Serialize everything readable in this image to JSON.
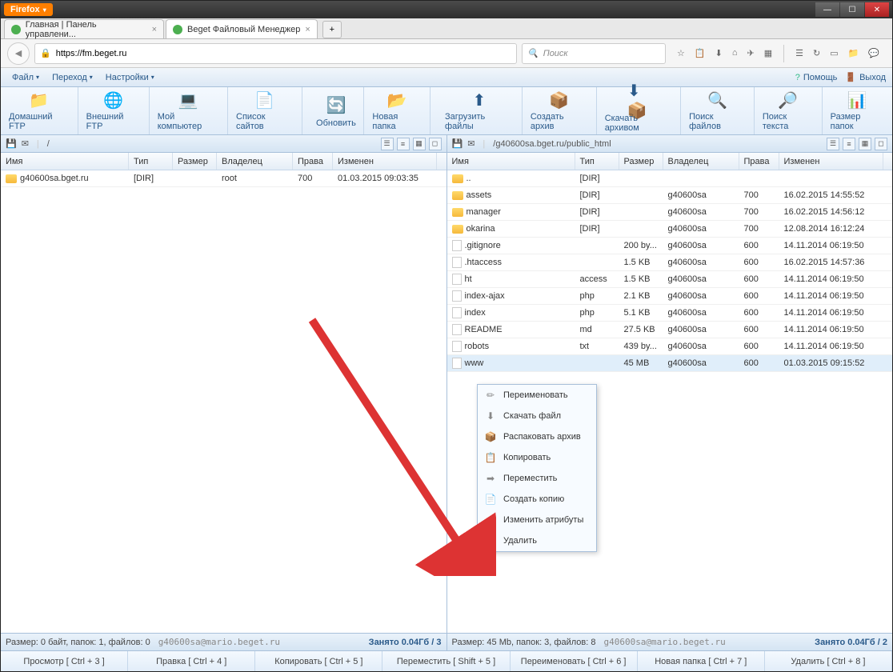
{
  "browser": {
    "name": "Firefox",
    "url": "https://fm.beget.ru",
    "search_placeholder": "Поиск"
  },
  "tabs": [
    {
      "title": "Главная | Панель управлени..."
    },
    {
      "title": "Beget Файловый Менеджер"
    }
  ],
  "menu": {
    "file": "Файл",
    "go": "Переход",
    "settings": "Настройки",
    "help": "Помощь",
    "exit": "Выход"
  },
  "toolbar": [
    {
      "label": "Домашний FTP"
    },
    {
      "label": "Внешний FTP"
    },
    {
      "label": "Мой компьютер"
    },
    {
      "label": "Список сайтов"
    },
    {
      "label": "Обновить"
    },
    {
      "label": "Новая папка"
    },
    {
      "label": "Загрузить файлы"
    },
    {
      "label": "Создать архив"
    },
    {
      "label": "Скачать архивом"
    },
    {
      "label": "Поиск файлов"
    },
    {
      "label": "Поиск текста"
    },
    {
      "label": "Размер папок"
    }
  ],
  "columns": {
    "name": "Имя",
    "type": "Тип",
    "size": "Размер",
    "owner": "Владелец",
    "perm": "Права",
    "modified": "Изменен"
  },
  "left_pane": {
    "path": "/",
    "rows": [
      {
        "name": "g40600sa.bget.ru",
        "type": "[DIR]",
        "size": "",
        "owner": "root",
        "perm": "700",
        "modified": "01.03.2015 09:03:35",
        "folder": true
      }
    ],
    "status": "Размер: 0 байт, папок: 1, файлов: 0",
    "user": "g40600sa@mario.beget.ru",
    "quota": "Занято 0.04Гб / 3"
  },
  "right_pane": {
    "path": "/g40600sa.bget.ru/public_html",
    "rows": [
      {
        "name": "..",
        "type": "[DIR]",
        "size": "",
        "owner": "",
        "perm": "",
        "modified": "",
        "folder": true
      },
      {
        "name": "assets",
        "type": "[DIR]",
        "size": "",
        "owner": "g40600sa",
        "perm": "700",
        "modified": "16.02.2015 14:55:52",
        "folder": true
      },
      {
        "name": "manager",
        "type": "[DIR]",
        "size": "",
        "owner": "g40600sa",
        "perm": "700",
        "modified": "16.02.2015 14:56:12",
        "folder": true
      },
      {
        "name": "okarina",
        "type": "[DIR]",
        "size": "",
        "owner": "g40600sa",
        "perm": "700",
        "modified": "12.08.2014 16:12:24",
        "folder": true
      },
      {
        "name": ".gitignore",
        "type": "",
        "size": "200 by...",
        "owner": "g40600sa",
        "perm": "600",
        "modified": "14.11.2014 06:19:50",
        "folder": false
      },
      {
        "name": ".htaccess",
        "type": "",
        "size": "1.5 KB",
        "owner": "g40600sa",
        "perm": "600",
        "modified": "16.02.2015 14:57:36",
        "folder": false
      },
      {
        "name": "ht",
        "type": "access",
        "size": "1.5 KB",
        "owner": "g40600sa",
        "perm": "600",
        "modified": "14.11.2014 06:19:50",
        "folder": false
      },
      {
        "name": "index-ajax",
        "type": "php",
        "size": "2.1 KB",
        "owner": "g40600sa",
        "perm": "600",
        "modified": "14.11.2014 06:19:50",
        "folder": false
      },
      {
        "name": "index",
        "type": "php",
        "size": "5.1 KB",
        "owner": "g40600sa",
        "perm": "600",
        "modified": "14.11.2014 06:19:50",
        "folder": false
      },
      {
        "name": "README",
        "type": "md",
        "size": "27.5 KB",
        "owner": "g40600sa",
        "perm": "600",
        "modified": "14.11.2014 06:19:50",
        "folder": false
      },
      {
        "name": "robots",
        "type": "txt",
        "size": "439 by...",
        "owner": "g40600sa",
        "perm": "600",
        "modified": "14.11.2014 06:19:50",
        "folder": false
      },
      {
        "name": "www",
        "type": "",
        "size": "45 MB",
        "owner": "g40600sa",
        "perm": "600",
        "modified": "01.03.2015 09:15:52",
        "folder": false,
        "selected": true
      }
    ],
    "status": "Размер: 45 Mb, папок: 3, файлов: 8",
    "user": "g40600sa@mario.beget.ru",
    "quota": "Занято 0.04Гб / 2"
  },
  "context_menu": [
    {
      "label": "Переименовать"
    },
    {
      "label": "Скачать файл"
    },
    {
      "label": "Распаковать архив"
    },
    {
      "label": "Копировать"
    },
    {
      "label": "Переместить"
    },
    {
      "label": "Создать копию"
    },
    {
      "label": "Изменить атрибуты"
    },
    {
      "label": "Удалить"
    }
  ],
  "bottom_buttons": [
    {
      "label": "Просмотр [ Ctrl + 3 ]"
    },
    {
      "label": "Правка [ Ctrl + 4 ]"
    },
    {
      "label": "Копировать [ Ctrl + 5 ]"
    },
    {
      "label": "Переместить [ Shift + 5 ]"
    },
    {
      "label": "Переименовать [ Ctrl + 6 ]"
    },
    {
      "label": "Новая папка [ Ctrl + 7 ]"
    },
    {
      "label": "Удалить [ Ctrl + 8 ]"
    }
  ],
  "col_widths": {
    "name": 160,
    "type": 55,
    "size": 55,
    "owner": 95,
    "perm": 50,
    "modified": 130
  }
}
